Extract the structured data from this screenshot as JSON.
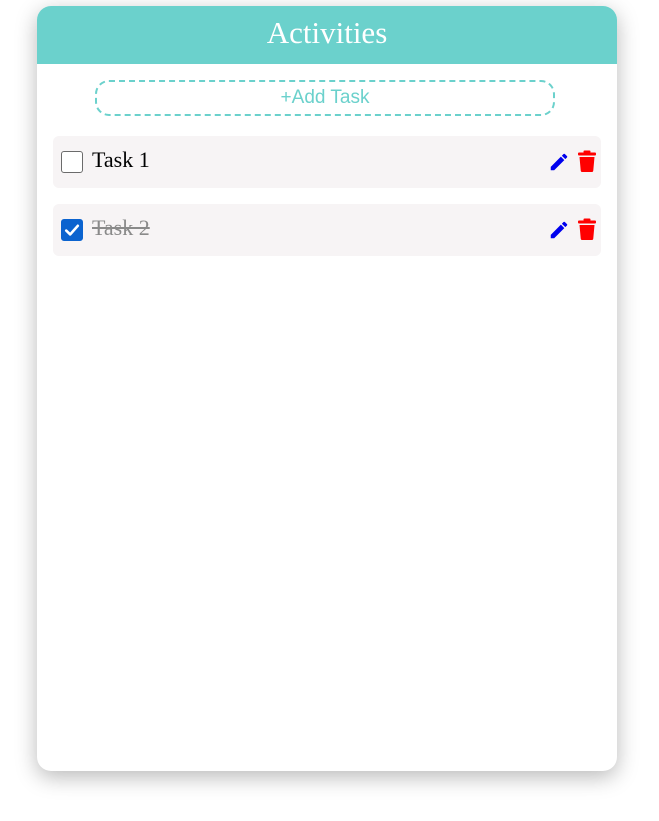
{
  "header": {
    "title": "Activities"
  },
  "add_task": {
    "label": "+Add Task"
  },
  "tasks": [
    {
      "label": "Task 1",
      "completed": false
    },
    {
      "label": "Task 2",
      "completed": true
    }
  ],
  "colors": {
    "accent": "#6bd1cc",
    "checkbox_checked": "#0b63cf",
    "edit_icon": "#0000ee",
    "delete_icon": "#ff0000",
    "task_background": "#f7f4f5"
  },
  "icons": {
    "edit": "pencil-icon",
    "delete": "trash-icon",
    "check": "checkmark-icon"
  }
}
